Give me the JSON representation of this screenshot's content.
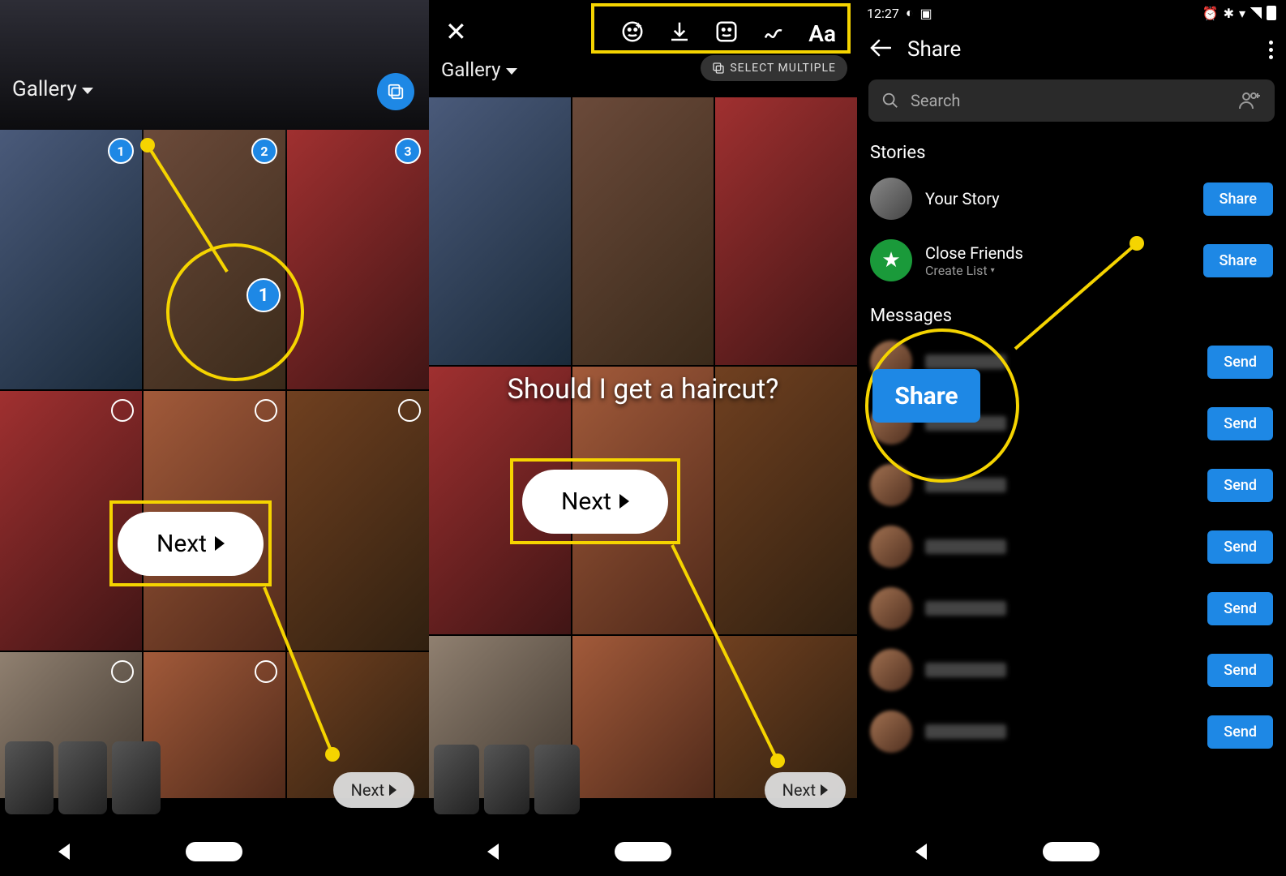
{
  "panel1": {
    "gallery_label": "Gallery",
    "next_small": "Next",
    "next_big": "Next",
    "selection_badges": [
      "1",
      "2",
      "3"
    ],
    "select_icon": "multi-select-icon"
  },
  "panel2": {
    "gallery_label": "Gallery",
    "select_multiple": "SELECT MULTIPLE",
    "caption": "Should I get a haircut?",
    "next_small": "Next",
    "next_big": "Next",
    "tools": {
      "effects": "effects-icon",
      "download": "download-icon",
      "sticker": "sticker-icon",
      "draw": "draw-icon",
      "text": "Aa"
    }
  },
  "panel3": {
    "status_time": "12:27",
    "title": "Share",
    "search_placeholder": "Search",
    "stories_header": "Stories",
    "your_story": "Your Story",
    "close_friends": "Close Friends",
    "create_list": "Create List",
    "messages_header": "Messages",
    "share_btn": "Share",
    "send_btn": "Send",
    "share_big": "Share",
    "message_rows": [
      1,
      2,
      3,
      4,
      5,
      6,
      7
    ]
  }
}
